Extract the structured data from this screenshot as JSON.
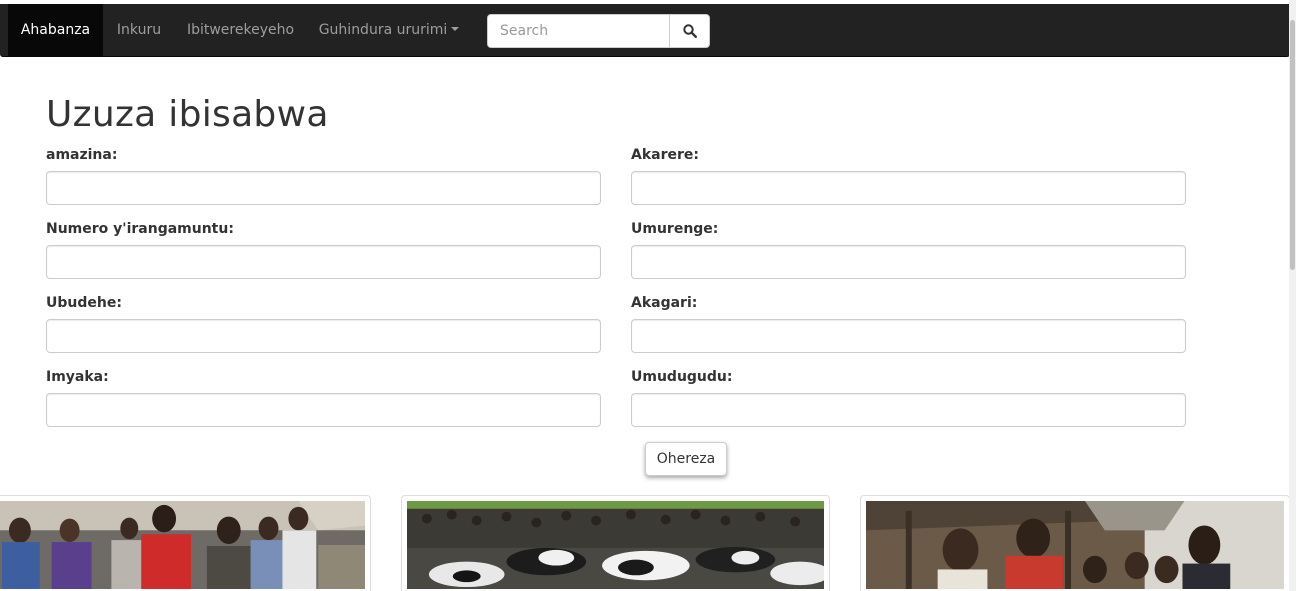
{
  "navbar": {
    "items": [
      {
        "label": "Ahabanza",
        "active": true
      },
      {
        "label": "Inkuru",
        "active": false
      },
      {
        "label": "Ibitwerekeyeho",
        "active": false
      },
      {
        "label": "Guhindura ururimi",
        "active": false,
        "dropdown": true
      }
    ],
    "search": {
      "placeholder": "Search",
      "value": "",
      "button_icon": "search-icon"
    }
  },
  "form": {
    "title": "Uzuza ibisabwa",
    "left_fields": [
      {
        "label": "amazina:",
        "value": ""
      },
      {
        "label": "Numero y'irangamuntu:",
        "value": ""
      },
      {
        "label": "Ubudehe:",
        "value": ""
      },
      {
        "label": "Imyaka:",
        "value": ""
      }
    ],
    "right_fields": [
      {
        "label": "Akarere:",
        "value": ""
      },
      {
        "label": "Umurenge:",
        "value": ""
      },
      {
        "label": "Akagari:",
        "value": ""
      },
      {
        "label": "Umudugudu:",
        "value": ""
      }
    ],
    "submit_label": "Ohereza"
  },
  "gallery": {
    "photos": [
      {
        "subject": "people-gathering-photo"
      },
      {
        "subject": "cattle-crowd-photo"
      },
      {
        "subject": "officials-group-photo"
      }
    ]
  },
  "colors": {
    "navbar_bg": "#222222",
    "navbar_active_bg": "#080808",
    "navbar_text": "#9d9d9d",
    "navbar_active_text": "#ffffff"
  }
}
